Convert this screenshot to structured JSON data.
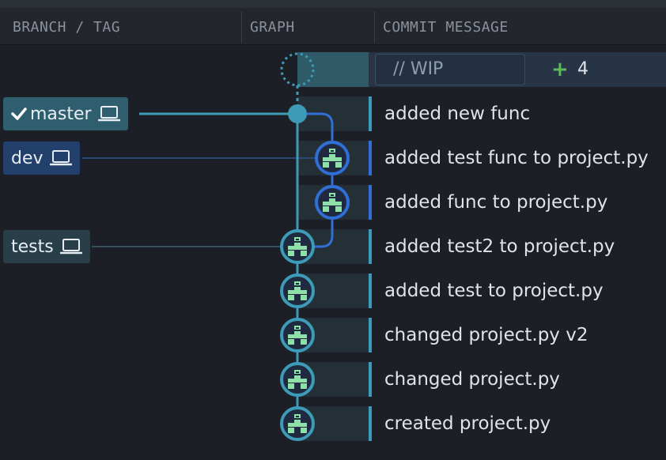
{
  "header": {
    "branch_tag": "BRANCH / TAG",
    "graph": "GRAPH",
    "commit_message": "COMMIT MESSAGE"
  },
  "wip": {
    "placeholder": "// WIP",
    "plus": "+",
    "count": "4"
  },
  "branches": {
    "master": "master",
    "dev": "dev",
    "tests": "tests"
  },
  "commits": [
    {
      "message": "added new func"
    },
    {
      "message": "added test func to project.py"
    },
    {
      "message": "added func to project.py"
    },
    {
      "message": "added test2 to project.py"
    },
    {
      "message": "added test to project.py"
    },
    {
      "message": "changed project.py v2"
    },
    {
      "message": "changed project.py"
    },
    {
      "message": "created project.py"
    }
  ],
  "colors": {
    "master_lane": "#3d9bb8",
    "dev_lane": "#2f6fd6",
    "avatar": "#8ee0a8",
    "background": "#1c1f25"
  }
}
